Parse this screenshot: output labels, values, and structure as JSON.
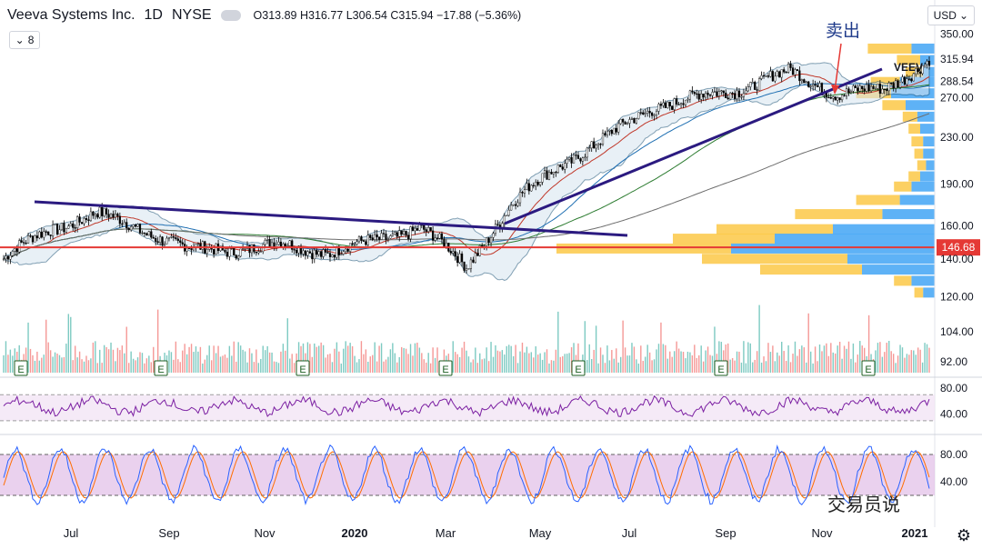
{
  "header": {
    "symbol_name": "Veeva Systems Inc.",
    "timeframe": "1D",
    "exchange": "NYSE",
    "ohlc": "O313.89 H316.77 L306.54 C315.94 −17.88 (−5.36%)",
    "collapse_label": "8",
    "currency": "USD"
  },
  "annotations": {
    "sell_label": "卖出",
    "ticker_label": "VEEV",
    "watermark": "交易员说"
  },
  "colors": {
    "up": "#26a69a",
    "down": "#ef5350",
    "trendline": "#2b1a80",
    "support": "#e53935",
    "rsi": "#7b1fa2",
    "rsi_band": "#f3e5f5",
    "stoch_k": "#2962ff",
    "stoch_d": "#ff6d00",
    "stoch_band": "#e1bee7",
    "vp_up": "#42a5f5",
    "vp_down": "#fbc02d"
  },
  "chart_data": [
    {
      "type": "candlestick",
      "title": "Veeva Systems Inc. 1D NYSE",
      "x_tick_labels": [
        "Jul",
        "Sep",
        "Nov",
        "2020",
        "Mar",
        "May",
        "Jul",
        "Sep",
        "Nov",
        "2021"
      ],
      "y_tick_labels": [
        "350.00",
        "315.94",
        "288.54",
        "270.00",
        "230.00",
        "190.00",
        "160.00",
        "146.68",
        "140.00",
        "120.00",
        "104.00",
        "92.00"
      ],
      "y_range": [
        88,
        360
      ],
      "log_scale": true,
      "last_price": 315.94,
      "sma_level_label": 288.54,
      "horizontal_support": 146.68,
      "earnings_markers": [
        "E",
        "E",
        "E",
        "E",
        "E",
        "E",
        "E",
        "E"
      ],
      "key_points": [
        {
          "date": "2019-05",
          "close": 140
        },
        {
          "date": "2019-06",
          "close": 158
        },
        {
          "date": "2019-07",
          "close": 168
        },
        {
          "date": "2019-08",
          "close": 158
        },
        {
          "date": "2019-09",
          "close": 145
        },
        {
          "date": "2019-10",
          "close": 146
        },
        {
          "date": "2019-11",
          "close": 148
        },
        {
          "date": "2019-12",
          "close": 144
        },
        {
          "date": "2020-01",
          "close": 150
        },
        {
          "date": "2020-02",
          "close": 160
        },
        {
          "date": "2020-03",
          "close": 135
        },
        {
          "date": "2020-04",
          "close": 175
        },
        {
          "date": "2020-05",
          "close": 205
        },
        {
          "date": "2020-06",
          "close": 228
        },
        {
          "date": "2020-07",
          "close": 260
        },
        {
          "date": "2020-08",
          "close": 270
        },
        {
          "date": "2020-09",
          "close": 282
        },
        {
          "date": "2020-10",
          "close": 300
        },
        {
          "date": "2020-11",
          "close": 275
        },
        {
          "date": "2020-12",
          "close": 278
        },
        {
          "date": "2021-01",
          "close": 315.94
        }
      ]
    },
    {
      "type": "line",
      "title": "RSI",
      "y_tick_labels": [
        "80.00",
        "40.00"
      ],
      "y_range": [
        20,
        90
      ]
    },
    {
      "type": "line",
      "title": "Stochastic",
      "y_tick_labels": [
        "80.00",
        "40.00"
      ],
      "y_range": [
        0,
        100
      ]
    }
  ]
}
